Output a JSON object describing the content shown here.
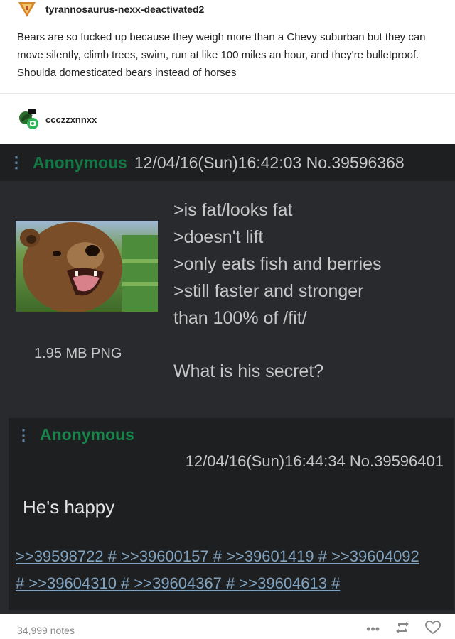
{
  "post": {
    "username": "tyrannosaurus-nexx-deactivated2",
    "body": "Bears are so fucked up because they weigh more than a Chevy suburban but they can move silently, climb trees, swim, run at like 100 miles an hour, and they're bulletproof. Shoulda domesticated bears instead of horses"
  },
  "reblog": {
    "username": "ccczzxnnxx"
  },
  "op": {
    "name": "Anonymous",
    "meta": "12/04/16(Sun)16:42:03 No.39596368",
    "file_info": "1.95 MB PNG",
    "lines": [
      ">is fat/looks fat",
      ">doesn't lift",
      ">only eats fish and berries",
      ">still faster and stronger",
      "than 100% of /fit/"
    ],
    "question": "What is his secret?"
  },
  "reply": {
    "name": "Anonymous",
    "meta": "12/04/16(Sun)16:44:34 No.39596401",
    "body": "He's happy",
    "backlinks_line1": ">>39598722 # >>39600157 # >>39601419 # >>39604092",
    "backlinks_line2": "# >>39604310 # >>39604367 # >>39604613 #"
  },
  "footer": {
    "notes": "34,999 notes"
  },
  "icons": [
    "triangle-avatar-icon",
    "reblog-icon",
    "heart-icon",
    "more-icon"
  ]
}
